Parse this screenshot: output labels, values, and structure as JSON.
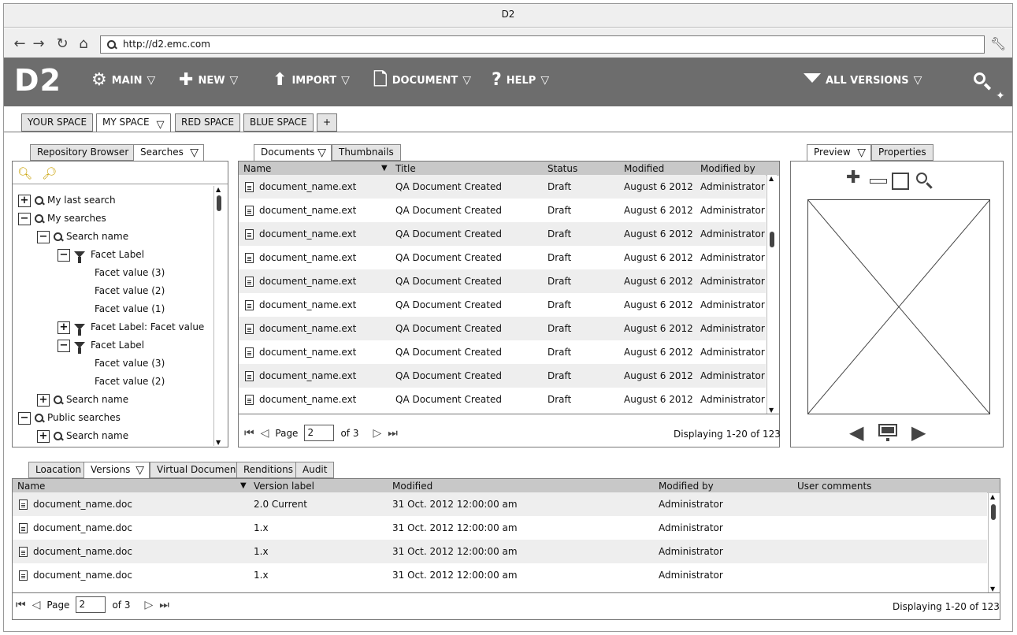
{
  "window": {
    "title": "D2"
  },
  "browser": {
    "url": "http://d2.emc.com"
  },
  "app": {
    "logo": "D2",
    "menus": [
      {
        "label": "MAIN",
        "icon": "gear-icon"
      },
      {
        "label": "NEW",
        "icon": "plus-icon"
      },
      {
        "label": "IMPORT",
        "icon": "upload-arrow-icon"
      },
      {
        "label": "DOCUMENT",
        "icon": "document-icon"
      },
      {
        "label": "HELP",
        "icon": "question-icon"
      }
    ],
    "version_filter": "ALL VERSIONS"
  },
  "spaces": {
    "tabs": [
      "YOUR SPACE",
      "MY SPACE",
      "RED SPACE",
      "BLUE SPACE",
      "+"
    ],
    "active": "MY SPACE"
  },
  "left_panel": {
    "tabs": [
      "Repository Browser",
      "Searches"
    ],
    "tree": [
      {
        "label": "My last search",
        "toggle": "+",
        "icon": "search",
        "indent": 0
      },
      {
        "label": "My searches",
        "toggle": "−",
        "icon": "search",
        "indent": 0
      },
      {
        "label": "Search name",
        "toggle": "−",
        "icon": "search",
        "indent": 1
      },
      {
        "label": "Facet Label",
        "toggle": "−",
        "icon": "filter",
        "indent": 2
      },
      {
        "label": "Facet value (3)",
        "toggle": "",
        "icon": "",
        "indent": 3
      },
      {
        "label": "Facet value (2)",
        "toggle": "",
        "icon": "",
        "indent": 3
      },
      {
        "label": "Facet value (1)",
        "toggle": "",
        "icon": "",
        "indent": 3
      },
      {
        "label": "Facet Label: Facet value",
        "toggle": "+",
        "icon": "filter",
        "indent": 2
      },
      {
        "label": "Facet Label",
        "toggle": "−",
        "icon": "filter",
        "indent": 2
      },
      {
        "label": "Facet value (3)",
        "toggle": "",
        "icon": "",
        "indent": 3
      },
      {
        "label": "Facet value (2)",
        "toggle": "",
        "icon": "",
        "indent": 3
      },
      {
        "label": "Search name",
        "toggle": "+",
        "icon": "search",
        "indent": 1
      },
      {
        "label": "Public searches",
        "toggle": "−",
        "icon": "search",
        "indent": 0
      },
      {
        "label": "Search name",
        "toggle": "+",
        "icon": "search",
        "indent": 1
      }
    ]
  },
  "documents": {
    "tabs": [
      "Documents",
      "Thumbnails"
    ],
    "columns": [
      "Name",
      "Title",
      "Status",
      "Modified",
      "Modified by"
    ],
    "rows": [
      [
        "document_name.ext",
        "QA Document Created",
        "Draft",
        "August 6 2012",
        "Administrator"
      ],
      [
        "document_name.ext",
        "QA Document Created",
        "Draft",
        "August 6 2012",
        "Administrator"
      ],
      [
        "document_name.ext",
        "QA Document Created",
        "Draft",
        "August 6 2012",
        "Administrator"
      ],
      [
        "document_name.ext",
        "QA Document Created",
        "Draft",
        "August 6 2012",
        "Administrator"
      ],
      [
        "document_name.ext",
        "QA Document Created",
        "Draft",
        "August 6 2012",
        "Administrator"
      ],
      [
        "document_name.ext",
        "QA Document Created",
        "Draft",
        "August 6 2012",
        "Administrator"
      ],
      [
        "document_name.ext",
        "QA Document Created",
        "Draft",
        "August 6 2012",
        "Administrator"
      ],
      [
        "document_name.ext",
        "QA Document Created",
        "Draft",
        "August 6 2012",
        "Administrator"
      ],
      [
        "document_name.ext",
        "QA Document Created",
        "Draft",
        "August 6 2012",
        "Administrator"
      ],
      [
        "document_name.ext",
        "QA Document Created",
        "Draft",
        "August 6 2012",
        "Administrator"
      ]
    ],
    "pager": {
      "page_label": "Page",
      "page": "2",
      "of_label": "of 3",
      "display": "Displaying 1-20 of 123"
    }
  },
  "preview": {
    "tabs": [
      "Preview",
      "Properties"
    ]
  },
  "bottom": {
    "tabs": [
      "Loacation",
      "Versions",
      "Virtual Document",
      "Renditions",
      "Audit"
    ],
    "columns": [
      "Name",
      "Version label",
      "Modified",
      "Modified by",
      "User comments"
    ],
    "rows": [
      [
        "document_name.doc",
        "2.0 Current",
        "31 Oct. 2012 12:00:00 am",
        "Administrator",
        ""
      ],
      [
        "document_name.doc",
        "1.x",
        "31 Oct. 2012 12:00:00 am",
        "Administrator",
        ""
      ],
      [
        "document_name.doc",
        "1.x",
        "31 Oct. 2012 12:00:00 am",
        "Administrator",
        ""
      ],
      [
        "document_name.doc",
        "1.x",
        "31 Oct. 2012 12:00:00 am",
        "Administrator",
        ""
      ]
    ],
    "pager": {
      "page_label": "Page",
      "page": "2",
      "of_label": "of 3",
      "display": "Displaying 1-20 of 123"
    }
  },
  "colors": {
    "appbar": "#6d6d6d",
    "header_row": "#c8c8c8",
    "alt_row": "#eeeeee"
  }
}
